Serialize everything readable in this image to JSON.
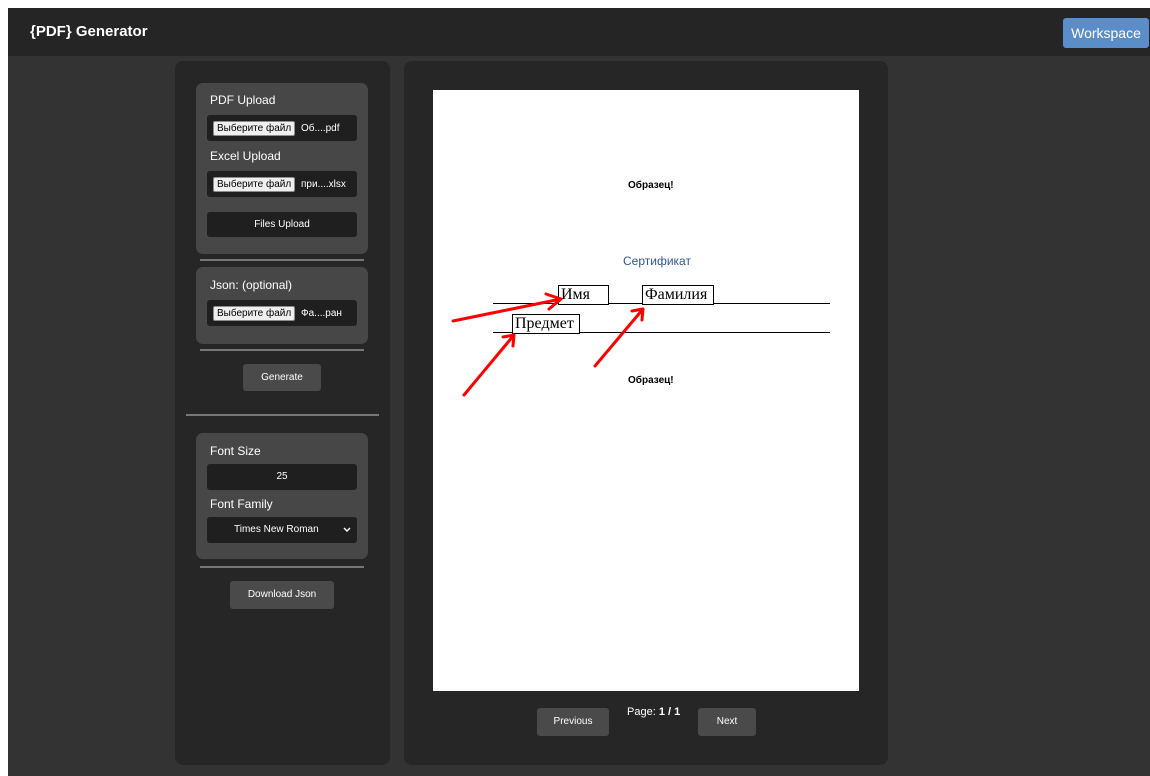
{
  "header": {
    "brand": "{PDF} Generator",
    "workspace_label": "Workspace",
    "accent": "#5b8ec9"
  },
  "upload": {
    "pdf_label": "PDF Upload",
    "pdf_button": "Выберите файл",
    "pdf_file": "Об....pdf",
    "excel_label": "Excel Upload",
    "excel_button": "Выберите файл",
    "excel_file": "при....xlsx",
    "submit_label": "Files Upload"
  },
  "json_section": {
    "label": "Json: (optional)",
    "button": "Выберите файл",
    "file": "Фа....ран"
  },
  "generate_label": "Generate",
  "font_settings": {
    "size_label": "Font Size",
    "size_value": "25",
    "family_label": "Font Family",
    "family_value": "Times New Roman",
    "chevron_icon": "chevron-down-icon"
  },
  "download_json_label": "Download Json",
  "preview": {
    "watermark_top": "Образец!",
    "title": "Сертификат",
    "field_name": "Имя",
    "field_surname": "Фамилия",
    "field_subject": "Предмет",
    "watermark_bottom": "Образец!",
    "arrow_color": "#ff0000"
  },
  "pagination": {
    "prev_label": "Previous",
    "page_prefix": "Page:",
    "page_value": "1 / 1",
    "next_label": "Next"
  }
}
